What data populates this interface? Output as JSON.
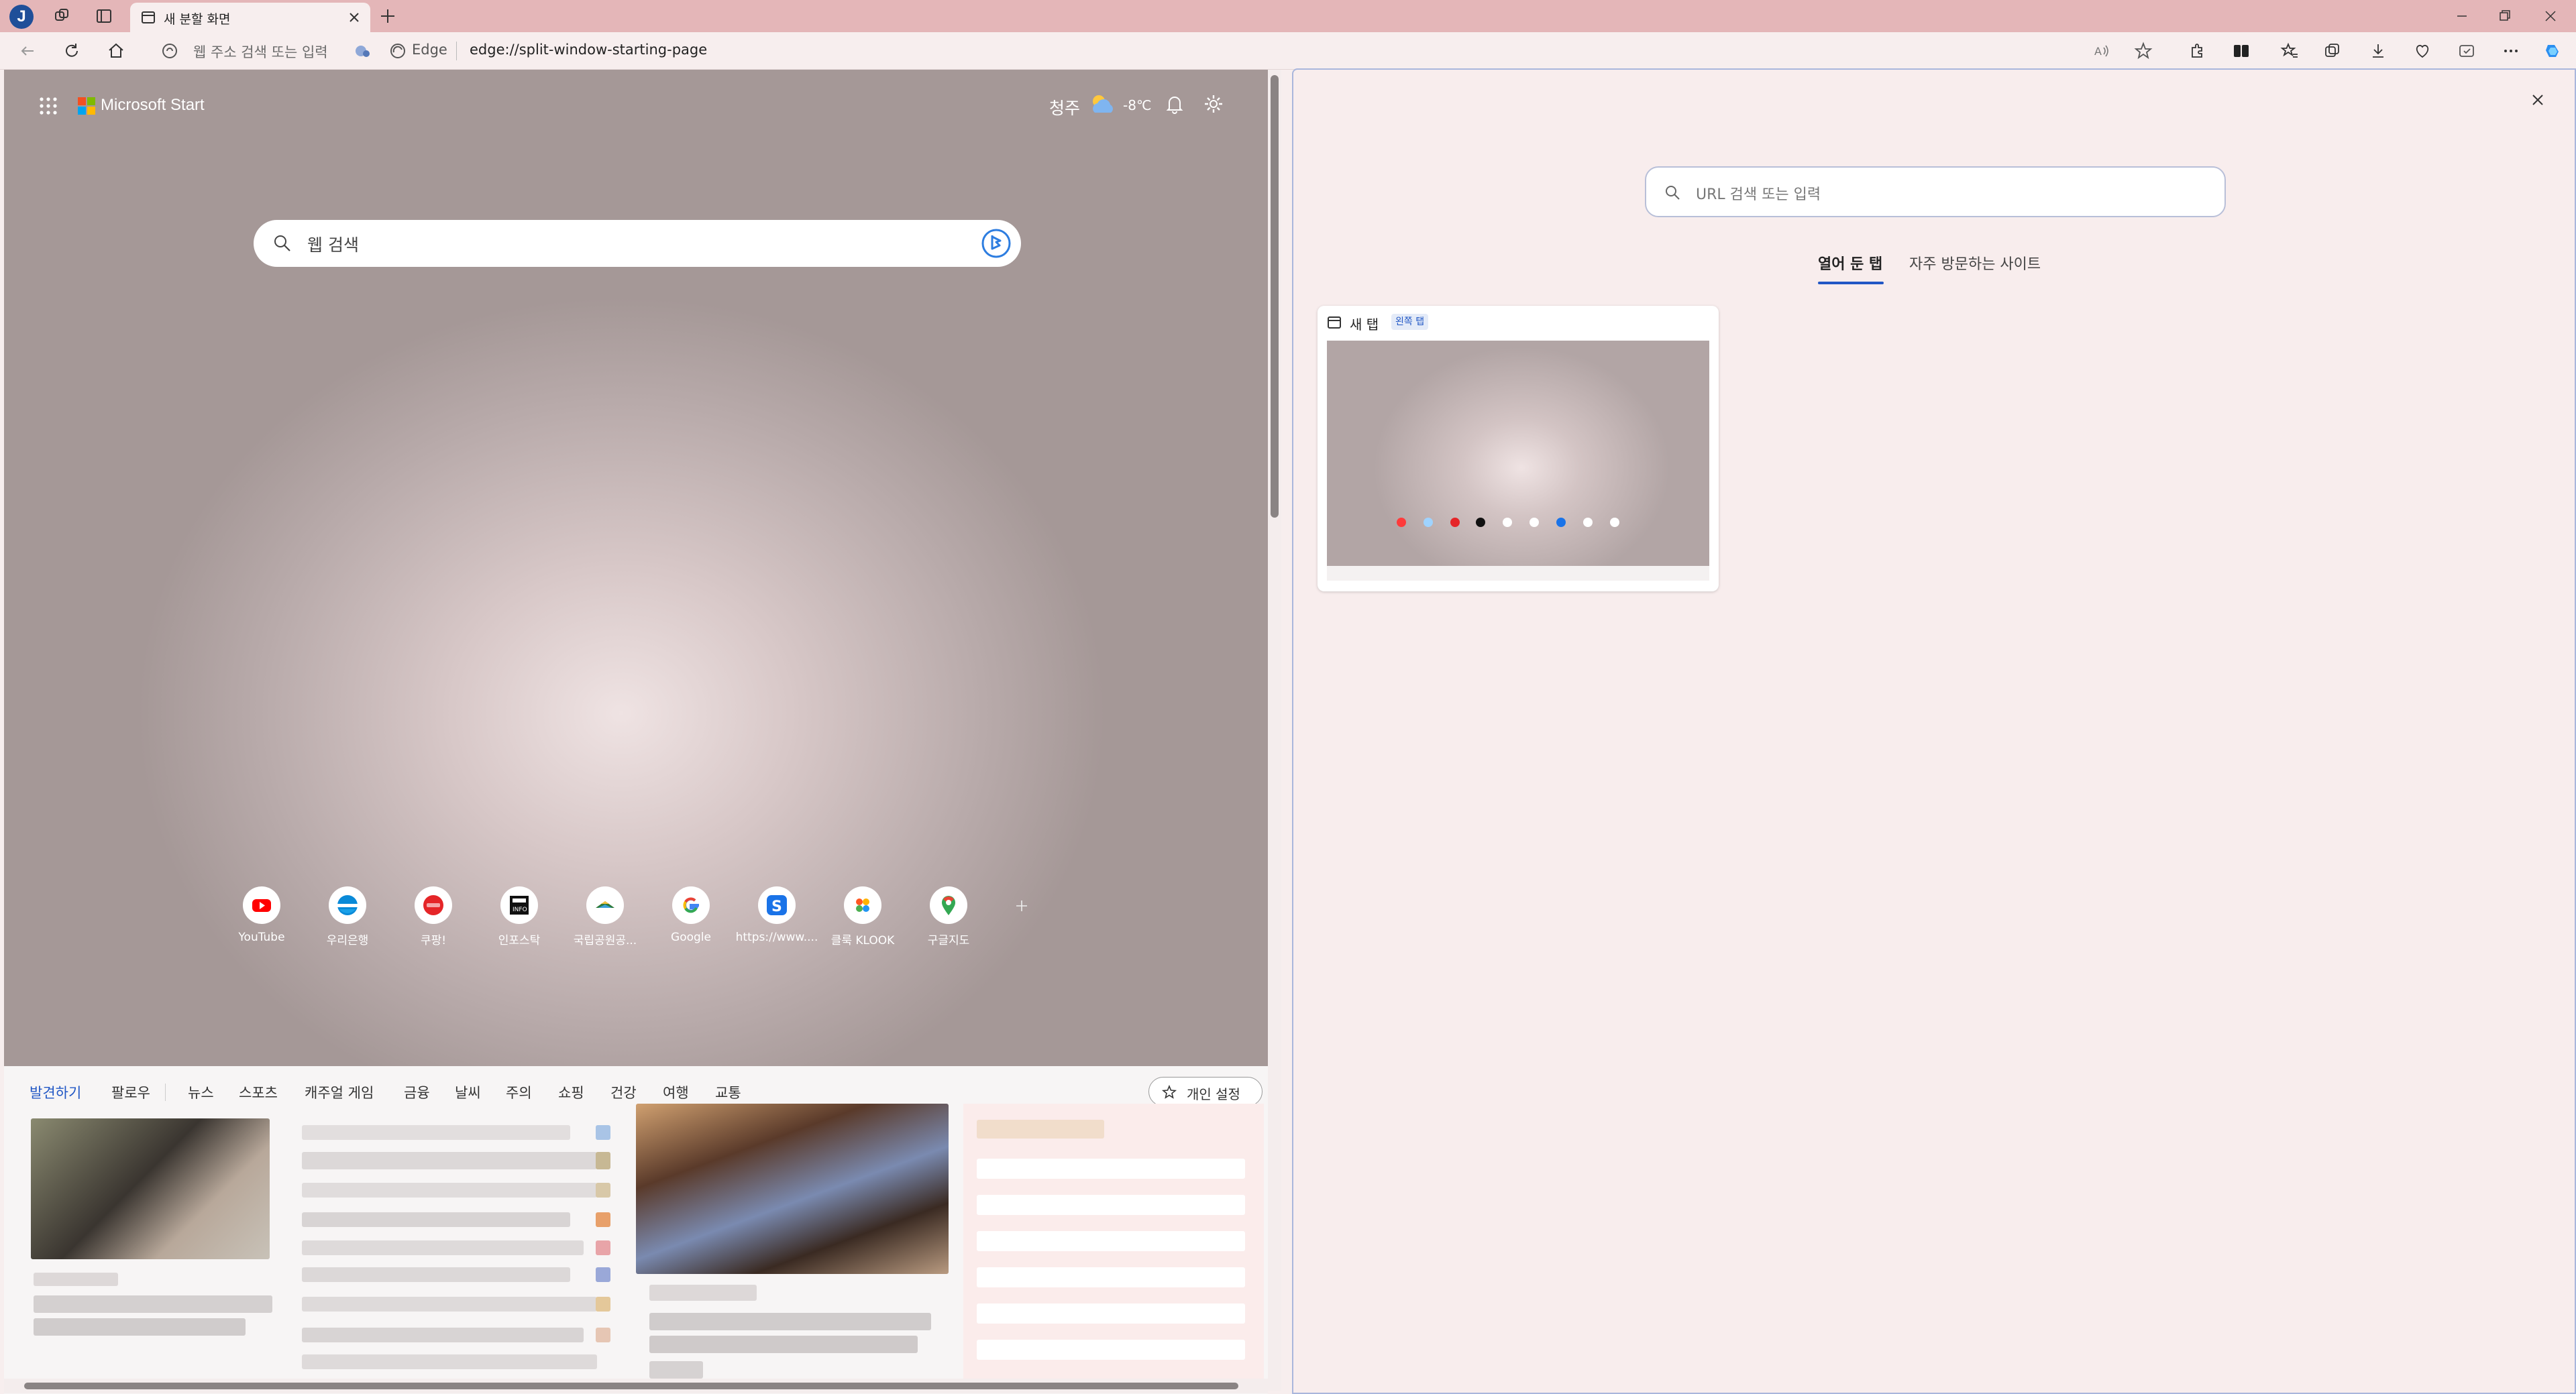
{
  "titlebar": {
    "profile_initial": "J",
    "tab_title": "새 분할 화면"
  },
  "addressbar": {
    "hint": "웹 주소 검색 또는 입력",
    "edge_label": "Edge",
    "url": "edge://split-window-starting-page"
  },
  "left": {
    "brand": "Microsoft Start",
    "weather": {
      "city": "청주",
      "temp": "-8℃"
    },
    "search_placeholder": "웹 검색",
    "tiles": [
      {
        "label": "YouTube",
        "icon": "youtube-icon",
        "color": "#ff0000"
      },
      {
        "label": "우리은행",
        "icon": "woori-bank-icon",
        "color": "#0a8ad8"
      },
      {
        "label": "쿠팡!",
        "icon": "coupang-icon",
        "color": "#e52528"
      },
      {
        "label": "인포스탁",
        "icon": "infostock-icon",
        "color": "#111111"
      },
      {
        "label": "국립공원공...",
        "icon": "national-park-icon",
        "color": "#2d7a3a"
      },
      {
        "label": "Google",
        "icon": "google-icon",
        "color": "#4285f4"
      },
      {
        "label": "https://www....",
        "icon": "s-site-icon",
        "color": "#1a73e8"
      },
      {
        "label": "클룩 KLOOK",
        "icon": "klook-icon",
        "color": "#ff5722"
      },
      {
        "label": "구글지도",
        "icon": "google-maps-icon",
        "color": "#34a853"
      }
    ],
    "feed_nav": [
      "발견하기",
      "팔로우",
      "뉴스",
      "스포츠",
      "캐주얼 게임",
      "금융",
      "날씨",
      "주의",
      "쇼핑",
      "건강",
      "여행",
      "교통"
    ],
    "personalize": "개인 설정"
  },
  "right": {
    "search_placeholder": "URL 검색 또는 입력",
    "tabs": [
      "열어 둔 탭",
      "자주 방문하는 사이트"
    ],
    "card_title": "새 탭",
    "card_badge": "왼쪽 탭"
  },
  "colors": {
    "accent": "#2157c5",
    "titlebar": "#e4b6b8",
    "pane_border": "#a9b6dc"
  }
}
